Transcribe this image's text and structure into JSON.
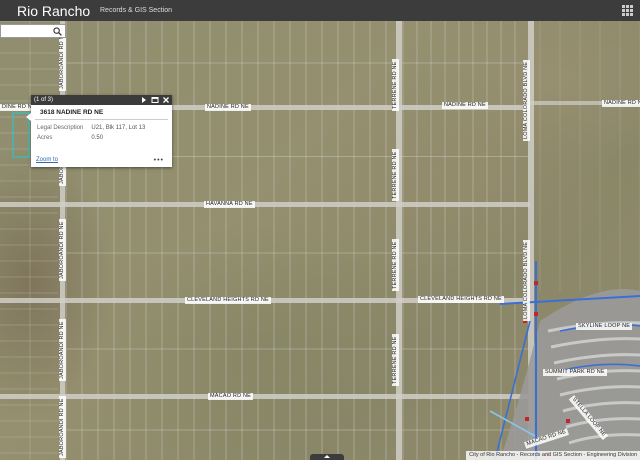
{
  "header": {
    "title": "Rio Rancho",
    "subtitle": "Records & GIS Section"
  },
  "search": {
    "value": "",
    "placeholder": ""
  },
  "popup": {
    "counter": "(1 of 3)",
    "title": "3618 NADINE RD NE",
    "fields": [
      {
        "label": "Legal Description",
        "value": "U21, Blk 117, Lot 13"
      },
      {
        "label": "Acres",
        "value": "0.50"
      }
    ],
    "zoom_label": "Zoom to",
    "more_label": "•••"
  },
  "roads": {
    "nadine": "NADINE RD NE",
    "nadine_left": "DINE RD NE",
    "havanna": "HAVANNA RD NE",
    "cleveland": "CLEVELAND HEIGHTS RD NE",
    "macao": "MACAO RD NE",
    "jaboro": "JABOROANDI RD NE",
    "terrene": "TERRENE RD NE",
    "loma": "LOMA COLORADO BLVD NE",
    "skyline": "SKYLINE LOOP NE",
    "summit": "SUMMIT PARK RD NE",
    "macao_right": "MACAO RD NE",
    "stella": "STELLA LOOP NE"
  },
  "attribution": "City of Rio Rancho - Records and GIS Section - Engineering Division",
  "colors": {
    "header": "#3c3c3c",
    "parcel_line": "#d8d8d8",
    "road": "#d0cfc8",
    "water_line": "#3a6fd8",
    "selected_parcel": "#2ec4c4"
  }
}
